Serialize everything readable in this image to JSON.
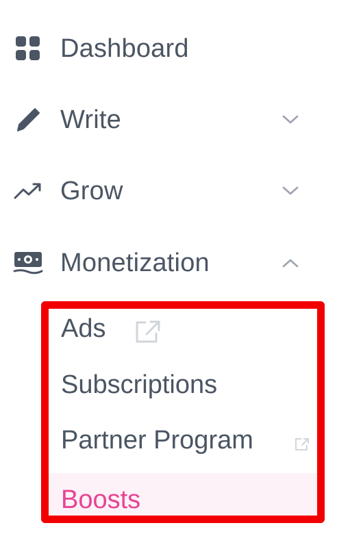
{
  "colors": {
    "text": "#4b5563",
    "icon": "#4b5563",
    "chevron": "#9ca3af",
    "external_icon": "#d1d5db",
    "active_text": "#e84393",
    "active_background": "#fdf2f8",
    "highlight_border": "#f20000"
  },
  "nav": {
    "items": [
      {
        "label": "Dashboard",
        "icon": "grid-icon",
        "chevron": null
      },
      {
        "label": "Write",
        "icon": "pencil-icon",
        "chevron": "chevron-down-icon"
      },
      {
        "label": "Grow",
        "icon": "trending-up-icon",
        "chevron": "chevron-down-icon"
      },
      {
        "label": "Monetization",
        "icon": "money-icon",
        "chevron": "chevron-up-icon",
        "expanded": true
      }
    ],
    "submenu": {
      "items": [
        {
          "label": "Ads",
          "external": true
        },
        {
          "label": "Subscriptions",
          "external": false
        },
        {
          "label": "Partner Program",
          "external": true
        },
        {
          "label": "Boosts",
          "external": false,
          "active": true
        }
      ]
    }
  }
}
